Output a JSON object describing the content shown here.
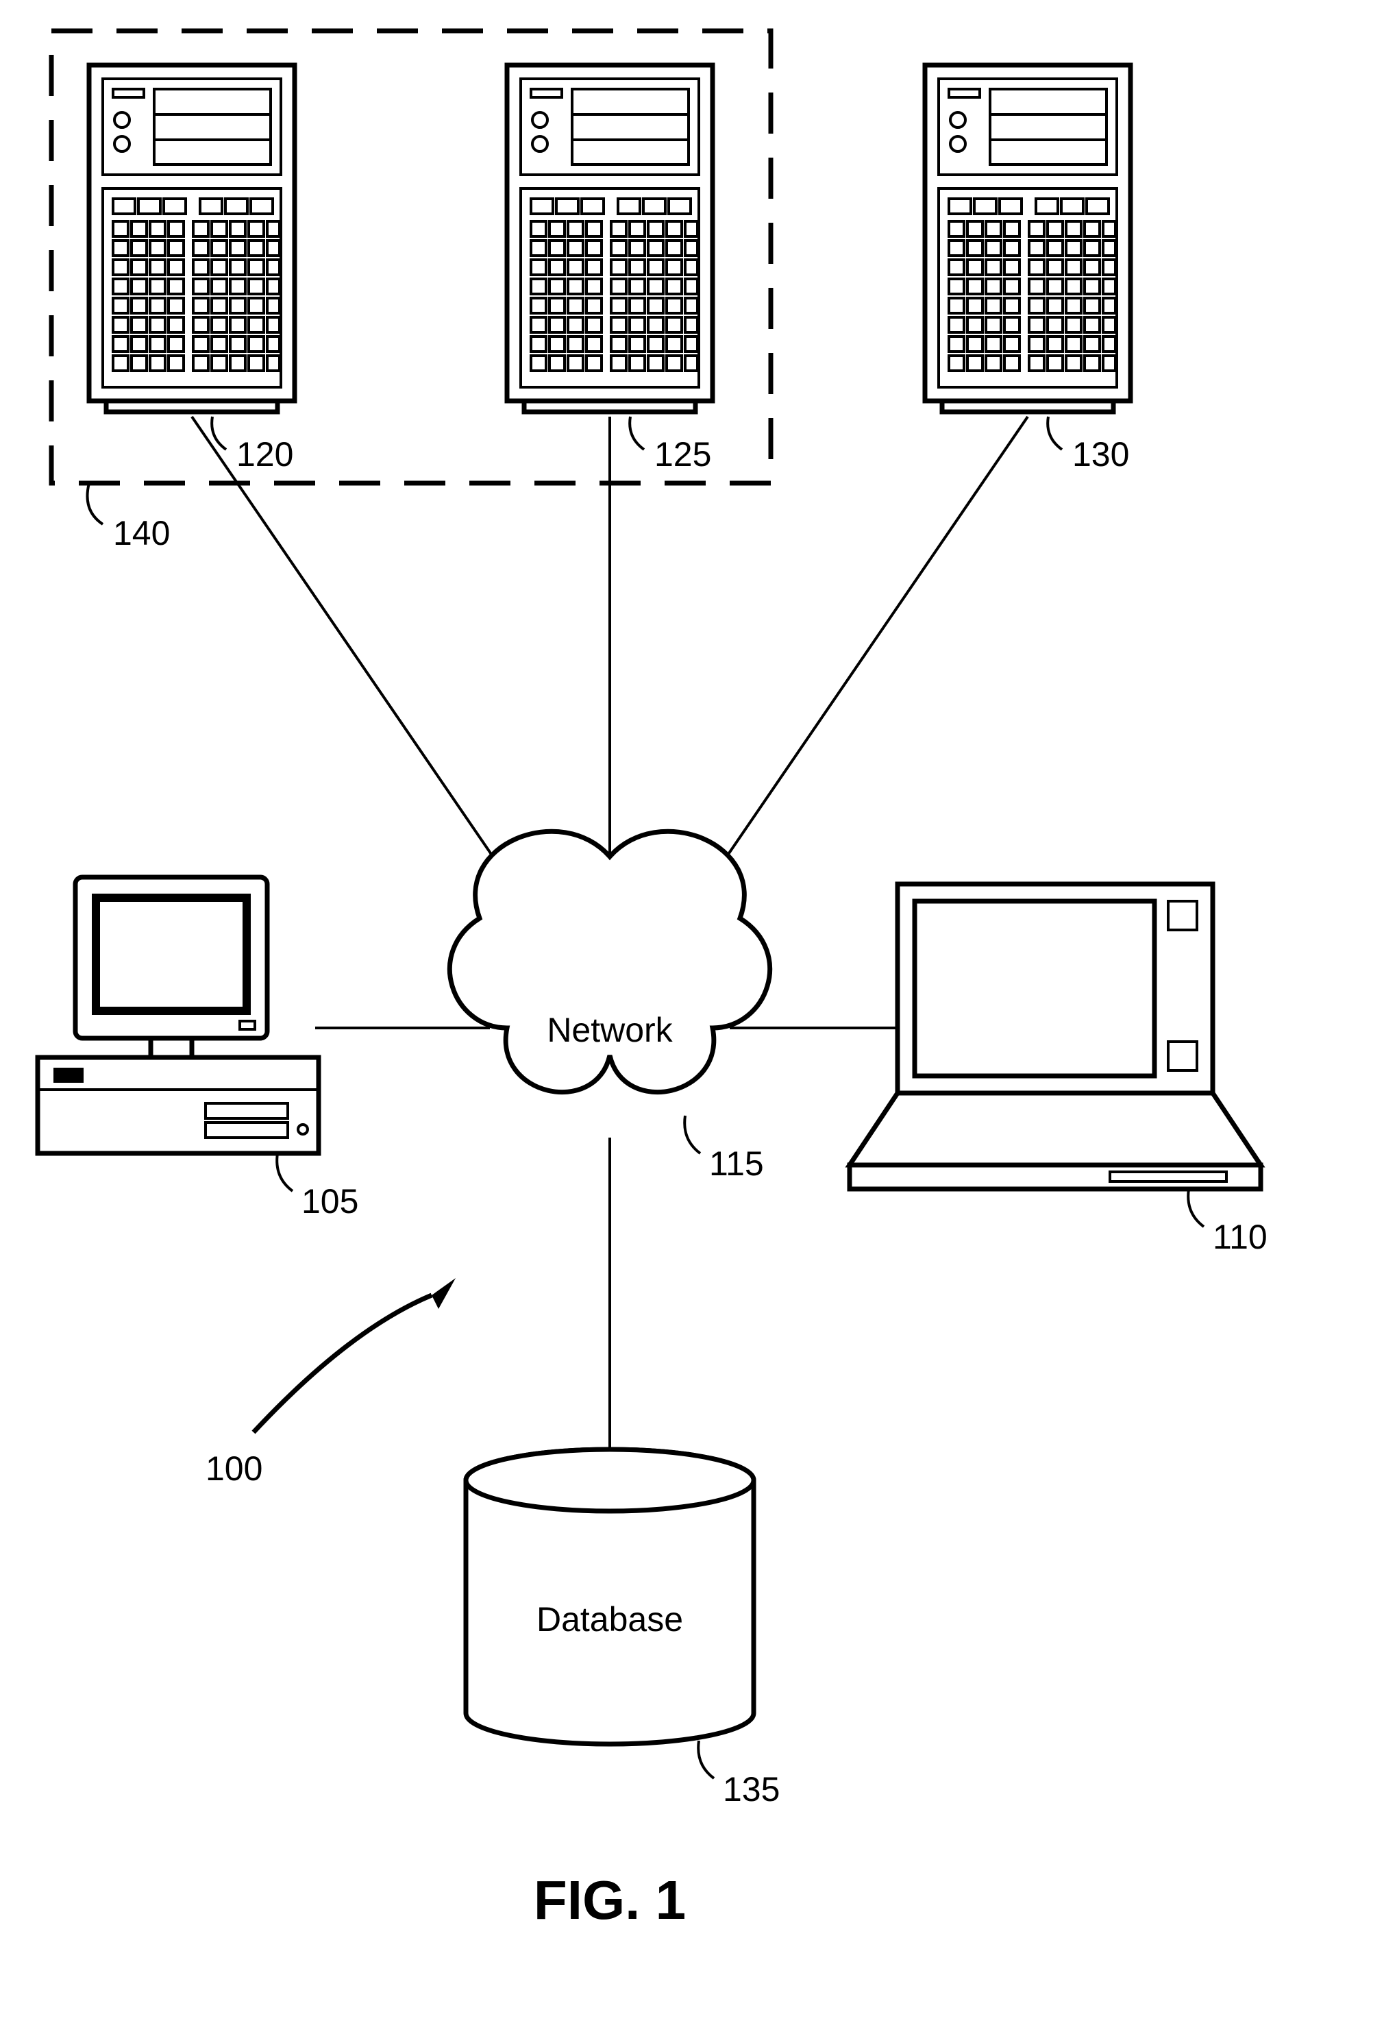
{
  "figure": {
    "title": "FIG. 1",
    "network_label": "Network",
    "database_label": "Database",
    "refs": {
      "server1": "120",
      "server2": "125",
      "server3": "130",
      "group": "140",
      "desktop": "105",
      "laptop": "110",
      "network": "115",
      "database": "135",
      "system": "100"
    }
  }
}
